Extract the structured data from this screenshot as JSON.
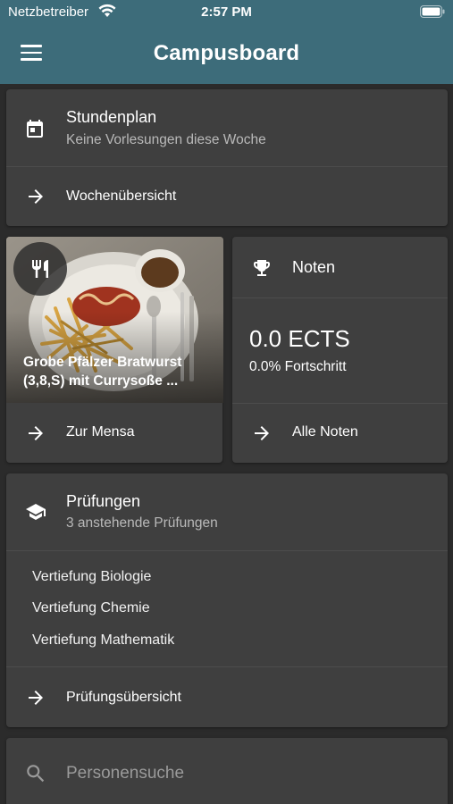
{
  "status_bar": {
    "carrier": "Netzbetreiber",
    "time": "2:57 PM"
  },
  "app_bar": {
    "title": "Campusboard"
  },
  "stundenplan": {
    "title": "Stundenplan",
    "subtitle": "Keine Vorlesungen diese Woche",
    "action": "Wochenübersicht"
  },
  "mensa": {
    "dish_line1": "Grobe Pfälzer Bratwurst",
    "dish_line2": "(3,8,S) mit Currysoße ...",
    "action": "Zur Mensa"
  },
  "noten": {
    "title": "Noten",
    "ects": "0.0 ECTS",
    "progress": "0.0% Fortschritt",
    "action": "Alle Noten"
  },
  "pruefungen": {
    "title": "Prüfungen",
    "subtitle": "3 anstehende Prüfungen",
    "items": [
      "Vertiefung Biologie",
      "Vertiefung Chemie",
      "Vertiefung Mathematik"
    ],
    "action": "Prüfungsübersicht"
  },
  "search": {
    "placeholder": "Personensuche"
  },
  "colors": {
    "app_bar": "#3d6c7a",
    "background": "#2b2b2b",
    "card": "#3f3f3f",
    "subtitle": "#b9b9b9"
  },
  "icons": [
    "wifi-icon",
    "battery-icon",
    "menu-icon",
    "calendar-icon",
    "arrow-right-icon",
    "restaurant-icon",
    "trophy-icon",
    "school-icon",
    "search-icon"
  ]
}
